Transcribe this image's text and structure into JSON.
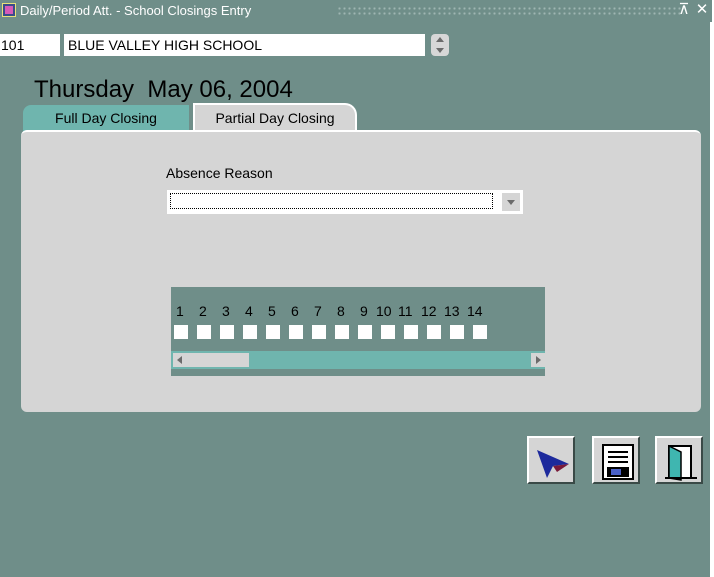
{
  "window": {
    "title": "Daily/Period Att. - School Closings Entry",
    "icons": [
      "app-icon",
      "maximize-icon",
      "close-icon"
    ],
    "maximize_glyph": "⊼",
    "close_glyph": "✕"
  },
  "school": {
    "code": "101",
    "name": "BLUE VALLEY HIGH SCHOOL"
  },
  "date_label": "Thursday  May 06, 2004",
  "tabs": [
    {
      "label": "Full Day Closing",
      "active": false
    },
    {
      "label": "Partial Day Closing",
      "active": true
    }
  ],
  "absence": {
    "label": "Absence Reason",
    "value": ""
  },
  "periods": [
    "1",
    "2",
    "3",
    "4",
    "5",
    "6",
    "7",
    "8",
    "9",
    "10",
    "11",
    "12",
    "13",
    "14"
  ],
  "toolbar": {
    "icons": [
      "pointer-arrow-icon",
      "save-disk-icon",
      "exit-door-icon"
    ]
  },
  "colors": {
    "window_bg": "#6f8e89",
    "panel_bg": "#d5d5d5",
    "tab_teal": "#6fb5ae"
  }
}
